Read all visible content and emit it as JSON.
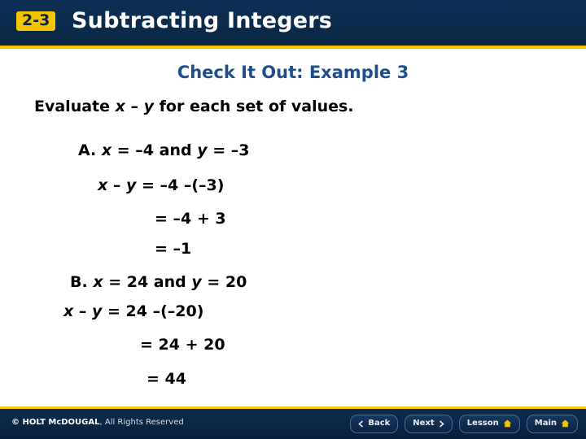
{
  "header": {
    "lesson_number": "2-3",
    "title": "Subtracting Integers"
  },
  "content": {
    "subtitle": "Check It Out: Example 3",
    "instruction_pre": "Evaluate ",
    "instruction_x": "x",
    "instruction_mid": " – ",
    "instruction_y": "y",
    "instruction_post": " for each set of values.",
    "part_a_label": "A. ",
    "part_a_x": "x",
    "part_a_given_mid": " = –4 and ",
    "part_a_y": "y",
    "part_a_given_end": " = –3",
    "a_step1_x": "x",
    "a_step1_mid": " – ",
    "a_step1_y": "y",
    "a_step1_end": " = –4 –(–3)",
    "a_step2": "= –4 + 3",
    "a_step3": "= –1",
    "part_b_label": "B. ",
    "part_b_x": "x",
    "part_b_given_mid": " = 24 and ",
    "part_b_y": "y",
    "part_b_given_end": " = 20",
    "b_step1_x": "x",
    "b_step1_mid": " – ",
    "b_step1_y": "y",
    "b_step1_end": " = 24 –(–20)",
    "b_step2": "= 24 + 20",
    "b_step3": "= 44"
  },
  "footer": {
    "copyright_brand": "© HOLT McDOUGAL",
    "copyright_rest": ", All Rights Reserved",
    "nav": {
      "back": "Back",
      "next": "Next",
      "lesson": "Lesson",
      "main": "Main"
    }
  },
  "colors": {
    "header_bg": "#0b2b4a",
    "badge_bg": "#f5c400",
    "subtitle": "#1e4f8a",
    "text": "#000000"
  }
}
